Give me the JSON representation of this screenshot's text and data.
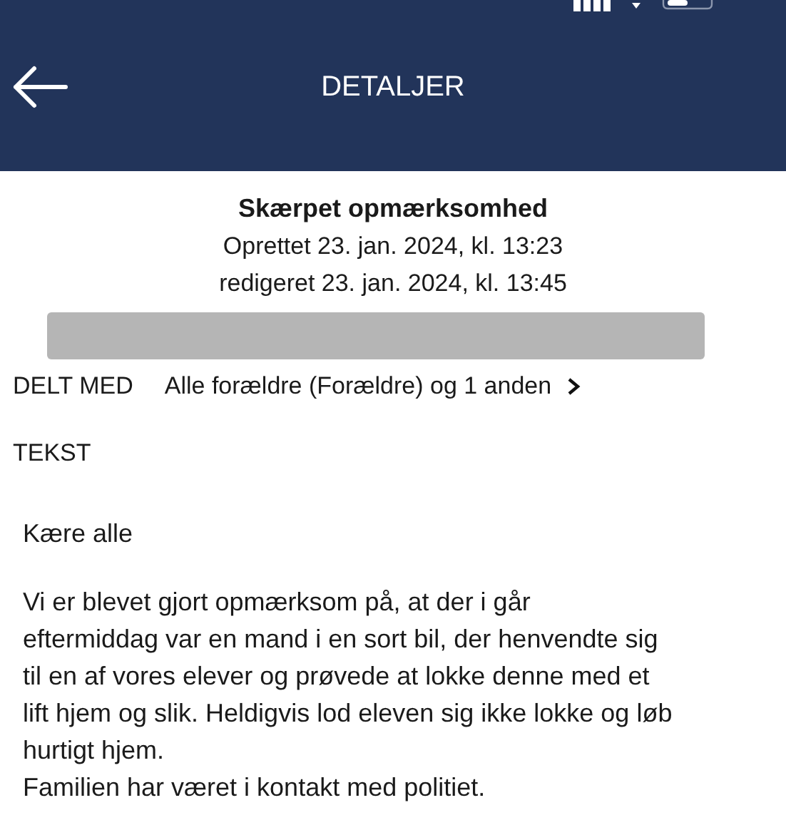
{
  "header": {
    "title": "DETALJER"
  },
  "message": {
    "subject": "Skærpet opmærksomhed",
    "created": "Oprettet 23. jan. 2024, kl. 13:23",
    "edited": "redigeret 23. jan. 2024, kl. 13:45"
  },
  "shared_with": {
    "label": "DELT MED",
    "value": "Alle forældre (Forældre) og 1 anden"
  },
  "text_section": {
    "label": "TEKST",
    "greeting": "Kære alle",
    "body_lines": [
      "Vi er blevet gjort opmærksom på, at der i går",
      "eftermiddag var en mand i en sort bil, der henvendte sig",
      "til  en af vores elever og prøvede at lokke denne med et",
      "lift hjem og slik. Heldigvis lod eleven sig ikke lokke og løb",
      "hurtigt hjem.",
      "Familien har været i kontakt med politiet."
    ]
  }
}
